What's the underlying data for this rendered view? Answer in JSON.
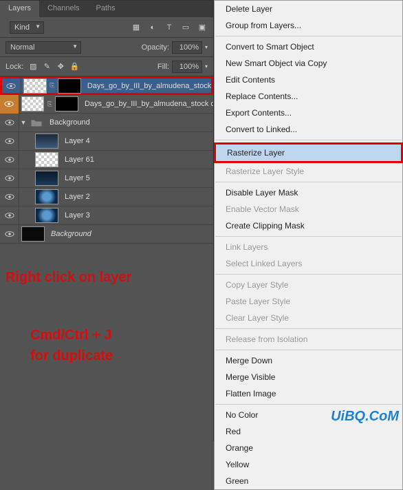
{
  "tabs": {
    "t1": "Layers",
    "t2": "Channels",
    "t3": "Paths"
  },
  "kind_label": "Kind",
  "blend": {
    "mode": "Normal",
    "opacity_label": "Opacity:",
    "opacity": "100%"
  },
  "lock": {
    "label": "Lock:",
    "fill_label": "Fill:",
    "fill": "100%"
  },
  "layers": {
    "sel": "Days_go_by_III_by_almudena_stock",
    "dup": "Days_go_by_III_by_almudena_stock c",
    "group": "Background",
    "l4": "Layer 4",
    "l61": "Layer 61",
    "l5": "Layer 5",
    "l2": "Layer 2",
    "l3": "Layer 3",
    "bg": "Background"
  },
  "annot": {
    "line1": "Right click on layer",
    "line2": "Cmd/Ctrl + J",
    "line3": "for duplicate"
  },
  "menu": {
    "delete": "Delete Layer",
    "group": "Group from Layers...",
    "csmart": "Convert to Smart Object",
    "newcopy": "New Smart Object via Copy",
    "edit": "Edit Contents",
    "replace": "Replace Contents...",
    "export": "Export Contents...",
    "linked": "Convert to Linked...",
    "raster": "Rasterize Layer",
    "rasterstyle": "Rasterize Layer Style",
    "disablemask": "Disable Layer Mask",
    "enablevec": "Enable Vector Mask",
    "clip": "Create Clipping Mask",
    "link": "Link Layers",
    "sellinked": "Select Linked Layers",
    "copystyle": "Copy Layer Style",
    "pastestyle": "Paste Layer Style",
    "clearstyle": "Clear Layer Style",
    "release": "Release from Isolation",
    "mergedown": "Merge Down",
    "mergevis": "Merge Visible",
    "flatten": "Flatten Image",
    "nocolor": "No Color",
    "red": "Red",
    "orange": "Orange",
    "yellow": "Yellow",
    "green": "Green"
  },
  "watermark": "UiBQ.CoM"
}
